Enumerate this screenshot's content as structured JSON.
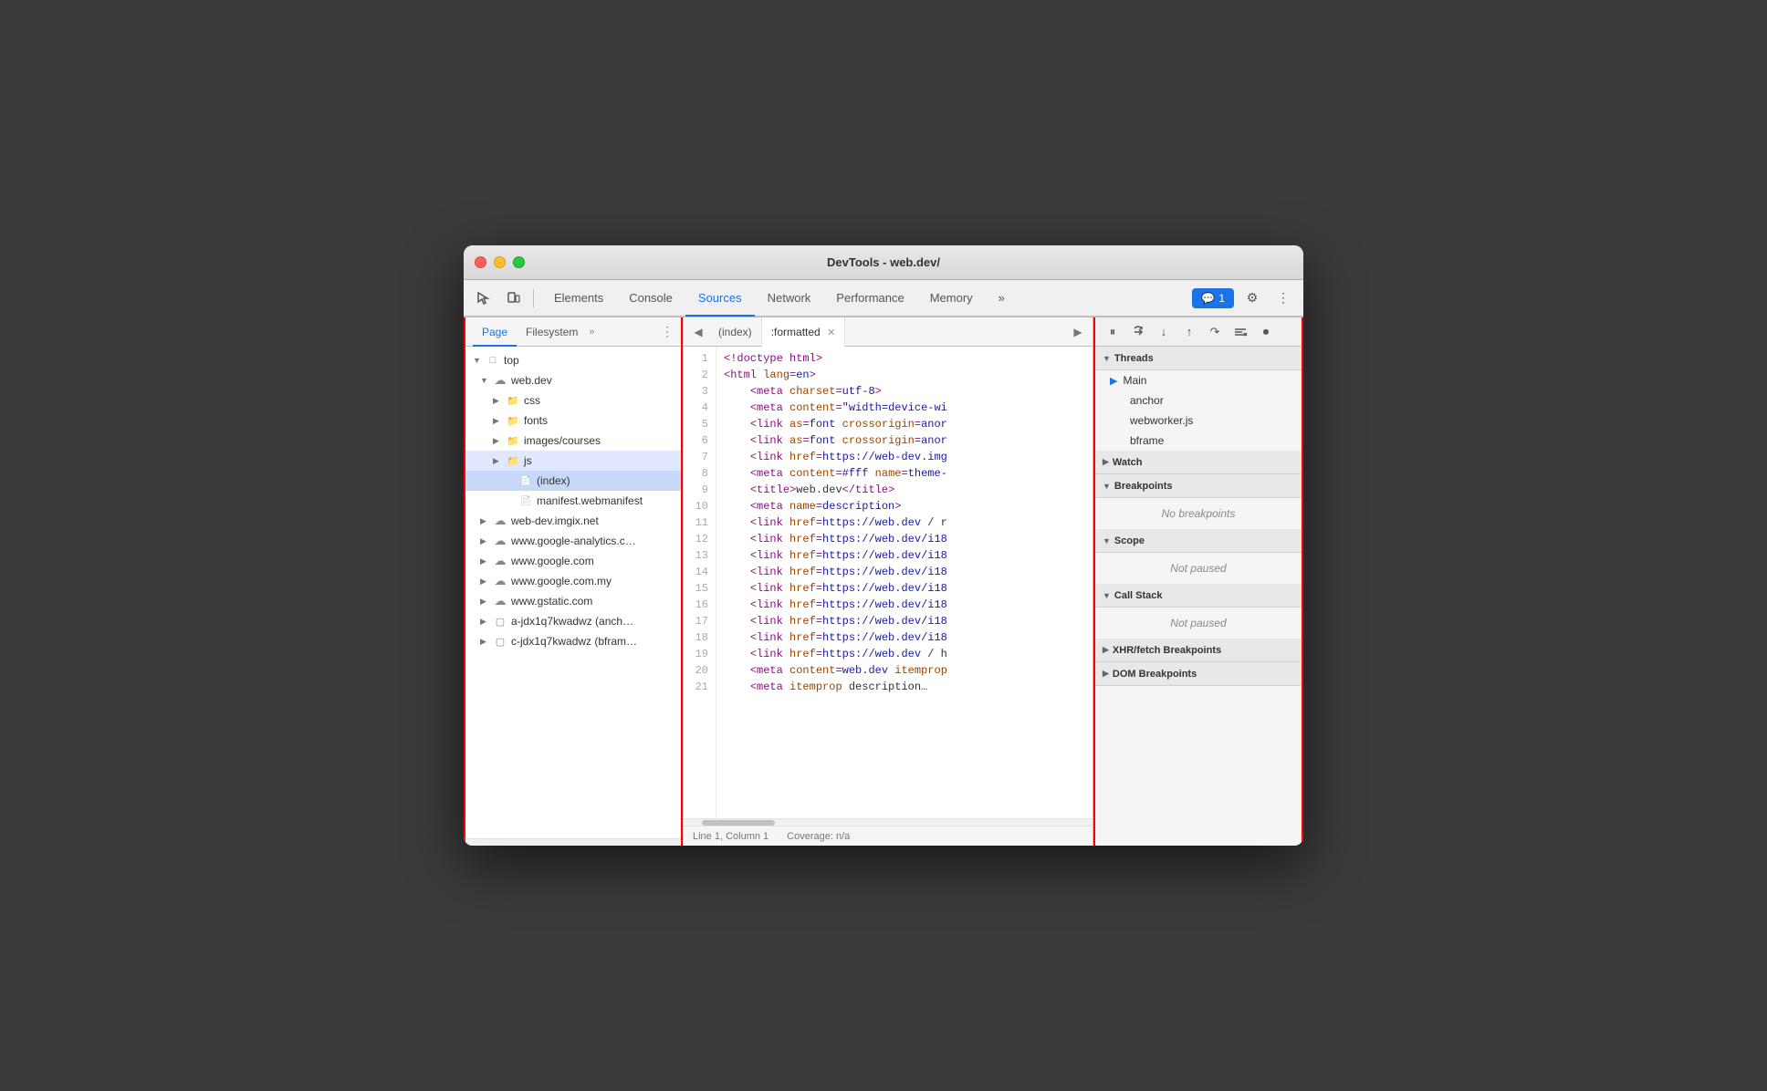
{
  "window": {
    "title": "DevTools - web.dev/"
  },
  "toolbar": {
    "tabs": [
      {
        "label": "Elements",
        "active": false
      },
      {
        "label": "Console",
        "active": false
      },
      {
        "label": "Sources",
        "active": true
      },
      {
        "label": "Network",
        "active": false
      },
      {
        "label": "Performance",
        "active": false
      },
      {
        "label": "Memory",
        "active": false
      }
    ],
    "more_label": "»",
    "messages_count": "1",
    "gear_icon": "⚙",
    "more_icon": "⋮"
  },
  "left_panel": {
    "tabs": [
      {
        "label": "Page",
        "active": true
      },
      {
        "label": "Filesystem",
        "active": false
      }
    ],
    "more_label": "»",
    "tree": [
      {
        "label": "top",
        "indent": 0,
        "type": "folder",
        "expanded": true
      },
      {
        "label": "web.dev",
        "indent": 1,
        "type": "cloud",
        "expanded": true
      },
      {
        "label": "css",
        "indent": 2,
        "type": "folder",
        "expanded": false
      },
      {
        "label": "fonts",
        "indent": 2,
        "type": "folder",
        "expanded": false
      },
      {
        "label": "images/courses",
        "indent": 2,
        "type": "folder",
        "expanded": false
      },
      {
        "label": "js",
        "indent": 2,
        "type": "folder",
        "expanded": false,
        "selected": false
      },
      {
        "label": "(index)",
        "indent": 3,
        "type": "file",
        "selected": true
      },
      {
        "label": "manifest.webmanifest",
        "indent": 3,
        "type": "file"
      },
      {
        "label": "web-dev.imgix.net",
        "indent": 1,
        "type": "cloud"
      },
      {
        "label": "www.google-analytics.c…",
        "indent": 1,
        "type": "cloud"
      },
      {
        "label": "www.google.com",
        "indent": 1,
        "type": "cloud"
      },
      {
        "label": "www.google.com.my",
        "indent": 1,
        "type": "cloud"
      },
      {
        "label": "www.gstatic.com",
        "indent": 1,
        "type": "cloud"
      },
      {
        "label": "a-jdx1q7kwadwz (anch…",
        "indent": 1,
        "type": "frame"
      },
      {
        "label": "c-jdx1q7kwadwz (bfram…",
        "indent": 1,
        "type": "frame"
      }
    ]
  },
  "editor": {
    "tabs": [
      {
        "label": "(index)",
        "active": false
      },
      {
        "label": ":formatted",
        "active": true,
        "closeable": true
      }
    ],
    "lines": [
      {
        "num": 1,
        "code": "<!doctype html>"
      },
      {
        "num": 2,
        "code": "<html lang=en>"
      },
      {
        "num": 3,
        "code": "    <meta charset=utf-8>"
      },
      {
        "num": 4,
        "code": "    <meta content=\"width=device-wi"
      },
      {
        "num": 5,
        "code": "    <link as=font crossorigin=anor"
      },
      {
        "num": 6,
        "code": "    <link as=font crossorigin=anor"
      },
      {
        "num": 7,
        "code": "    <link href=https://web-dev.img"
      },
      {
        "num": 8,
        "code": "    <meta content=#fff name=theme-"
      },
      {
        "num": 9,
        "code": "    <title>web.dev</title>"
      },
      {
        "num": 10,
        "code": "    <meta name=description>"
      },
      {
        "num": 11,
        "code": "    <link href=https://web.dev / r"
      },
      {
        "num": 12,
        "code": "    <link href=https://web.dev/i18"
      },
      {
        "num": 13,
        "code": "    <link href=https://web.dev/i18"
      },
      {
        "num": 14,
        "code": "    <link href=https://web.dev/i18"
      },
      {
        "num": 15,
        "code": "    <link href=https://web.dev/i18"
      },
      {
        "num": 16,
        "code": "    <link href=https://web.dev/i18"
      },
      {
        "num": 17,
        "code": "    <link href=https://web.dev/i18"
      },
      {
        "num": 18,
        "code": "    <link href=https://web.dev/i18"
      },
      {
        "num": 19,
        "code": "    <link href=https://web.dev / h"
      },
      {
        "num": 20,
        "code": "    <meta content=web.dev itemprop"
      },
      {
        "num": 21,
        "code": "    <meta itemprop description…"
      }
    ],
    "status": {
      "position": "Line 1, Column 1",
      "coverage": "Coverage: n/a"
    }
  },
  "right_panel": {
    "debug_buttons": [
      "⏸",
      "↺",
      "↓",
      "↑",
      "↷",
      "✎",
      "⏺"
    ],
    "sections": {
      "threads": {
        "label": "Threads",
        "items": [
          "Main",
          "anchor",
          "webworker.js",
          "bframe"
        ]
      },
      "watch": {
        "label": "Watch"
      },
      "breakpoints": {
        "label": "Breakpoints",
        "empty_text": "No breakpoints"
      },
      "scope": {
        "label": "Scope",
        "empty_text": "Not paused"
      },
      "call_stack": {
        "label": "Call Stack",
        "empty_text": "Not paused"
      },
      "xhr_breakpoints": {
        "label": "XHR/fetch Breakpoints"
      },
      "dom_breakpoints": {
        "label": "DOM Breakpoints"
      }
    }
  }
}
